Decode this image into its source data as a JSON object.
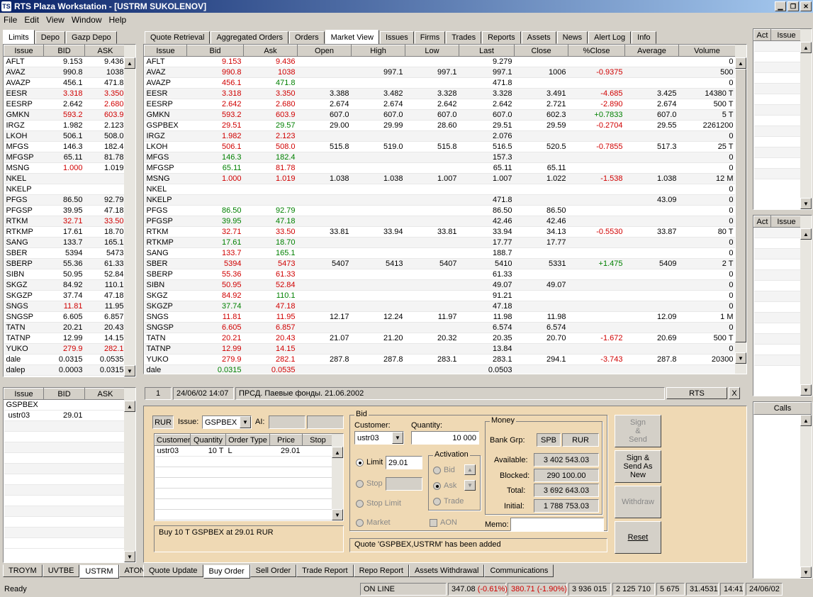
{
  "window": {
    "title": "RTS Plaza Workstation - [USTRM SUKOLENOV]"
  },
  "menu": [
    "File",
    "Edit",
    "View",
    "Window",
    "Help"
  ],
  "left_tabs": [
    "Limits",
    "Depo",
    "Gazp Depo"
  ],
  "left_grid": {
    "headers": [
      "Issue",
      "BID",
      "ASK"
    ],
    "rows": [
      [
        "AFLT",
        "9.153",
        "9.436",
        "",
        ""
      ],
      [
        "AVAZ",
        "990.8",
        "1038",
        "",
        ""
      ],
      [
        "AVAZP",
        "456.1",
        "471.8",
        "",
        ""
      ],
      [
        "EESR",
        "3.318",
        "3.350",
        "red",
        "red"
      ],
      [
        "EESRP",
        "2.642",
        "2.680",
        "",
        "red"
      ],
      [
        "GMKN",
        "593.2",
        "603.9",
        "red",
        "red"
      ],
      [
        "IRGZ",
        "1.982",
        "2.123",
        "",
        ""
      ],
      [
        "LKOH",
        "506.1",
        "508.0",
        "",
        ""
      ],
      [
        "MFGS",
        "146.3",
        "182.4",
        "",
        ""
      ],
      [
        "MFGSP",
        "65.11",
        "81.78",
        "",
        ""
      ],
      [
        "MSNG",
        "1.000",
        "1.019",
        "red",
        ""
      ],
      [
        "NKEL",
        "",
        "",
        "",
        ""
      ],
      [
        "NKELP",
        "",
        "",
        "",
        ""
      ],
      [
        "PFGS",
        "86.50",
        "92.79",
        "",
        ""
      ],
      [
        "PFGSP",
        "39.95",
        "47.18",
        "",
        ""
      ],
      [
        "RTKM",
        "32.71",
        "33.50",
        "red",
        "red"
      ],
      [
        "RTKMP",
        "17.61",
        "18.70",
        "",
        ""
      ],
      [
        "SANG",
        "133.7",
        "165.1",
        "",
        ""
      ],
      [
        "SBER",
        "5394",
        "5473",
        "",
        ""
      ],
      [
        "SBERP",
        "55.36",
        "61.33",
        "",
        ""
      ],
      [
        "SIBN",
        "50.95",
        "52.84",
        "",
        ""
      ],
      [
        "SKGZ",
        "84.92",
        "110.1",
        "",
        ""
      ],
      [
        "SKGZP",
        "37.74",
        "47.18",
        "",
        ""
      ],
      [
        "SNGS",
        "11.81",
        "11.95",
        "red",
        ""
      ],
      [
        "SNGSP",
        "6.605",
        "6.857",
        "",
        ""
      ],
      [
        "TATN",
        "20.21",
        "20.43",
        "",
        ""
      ],
      [
        "TATNP",
        "12.99",
        "14.15",
        "",
        ""
      ],
      [
        "YUKO",
        "279.9",
        "282.1",
        "red",
        "red"
      ],
      [
        "dale",
        "0.0315",
        "0.0535",
        "",
        ""
      ],
      [
        "dalep",
        "0.0003",
        "0.0315",
        "",
        ""
      ]
    ]
  },
  "left_lower_grid": {
    "headers": [
      "Issue",
      "BID",
      "ASK"
    ],
    "rows": [
      [
        "GSPBEX",
        "",
        ""
      ],
      [
        "ustr03",
        "29.01",
        ""
      ]
    ]
  },
  "left_bottom_tabs": [
    "TROYM",
    "UVTBE",
    "USTRM",
    "ATONM"
  ],
  "main_tabs": [
    "Quote Retrieval",
    "Aggregated Orders",
    "Orders",
    "Market View",
    "Issues",
    "Firms",
    "Trades",
    "Reports",
    "Assets",
    "News",
    "Alert Log",
    "Info"
  ],
  "market": {
    "headers": [
      "Issue",
      "Bid",
      "Ask",
      "Open",
      "High",
      "Low",
      "Last",
      "Close",
      "%Close",
      "Average",
      "Volume"
    ],
    "rows": [
      [
        "AFLT",
        "9.153",
        "9.436",
        "",
        "",
        "",
        "9.279",
        "",
        "",
        "",
        "0",
        "red",
        "red",
        ""
      ],
      [
        "AVAZ",
        "990.8",
        "1038",
        "",
        "997.1",
        "997.1",
        "997.1",
        "1006",
        "-0.9375",
        "",
        "500",
        "red",
        "red",
        "red"
      ],
      [
        "AVAZP",
        "456.1",
        "471.8",
        "",
        "",
        "",
        "471.8",
        "",
        "",
        "",
        "0",
        "red",
        "green",
        ""
      ],
      [
        "EESR",
        "3.318",
        "3.350",
        "3.388",
        "3.482",
        "3.328",
        "3.328",
        "3.491",
        "-4.685",
        "3.425",
        "14380 T",
        "red",
        "red",
        "red"
      ],
      [
        "EESRP",
        "2.642",
        "2.680",
        "2.674",
        "2.674",
        "2.642",
        "2.642",
        "2.721",
        "-2.890",
        "2.674",
        "500 T",
        "red",
        "red",
        "red"
      ],
      [
        "GMKN",
        "593.2",
        "603.9",
        "607.0",
        "607.0",
        "607.0",
        "607.0",
        "602.3",
        "+0.7833",
        "607.0",
        "5 T",
        "red",
        "red",
        "green"
      ],
      [
        "GSPBEX",
        "29.51",
        "29.57",
        "29.00",
        "29.99",
        "28.60",
        "29.51",
        "29.59",
        "-0.2704",
        "29.55",
        "2261200",
        "red",
        "green",
        "red"
      ],
      [
        "IRGZ",
        "1.982",
        "2.123",
        "",
        "",
        "",
        "2.076",
        "",
        "",
        "",
        "0",
        "red",
        "red",
        ""
      ],
      [
        "LKOH",
        "506.1",
        "508.0",
        "515.8",
        "519.0",
        "515.8",
        "516.5",
        "520.5",
        "-0.7855",
        "517.3",
        "25 T",
        "red",
        "red",
        "red"
      ],
      [
        "MFGS",
        "146.3",
        "182.4",
        "",
        "",
        "",
        "157.3",
        "",
        "",
        "",
        "0",
        "green",
        "green",
        ""
      ],
      [
        "MFGSP",
        "65.11",
        "81.78",
        "",
        "",
        "",
        "65.11",
        "65.11",
        "",
        "",
        "0",
        "green",
        "red",
        ""
      ],
      [
        "MSNG",
        "1.000",
        "1.019",
        "1.038",
        "1.038",
        "1.007",
        "1.007",
        "1.022",
        "-1.538",
        "1.038",
        "12 M",
        "red",
        "red",
        "red"
      ],
      [
        "NKEL",
        "",
        "",
        "",
        "",
        "",
        "",
        "",
        "",
        "",
        "0",
        "",
        "",
        ""
      ],
      [
        "NKELP",
        "",
        "",
        "",
        "",
        "",
        "471.8",
        "",
        "",
        "43.09",
        "0",
        "",
        "",
        ""
      ],
      [
        "PFGS",
        "86.50",
        "92.79",
        "",
        "",
        "",
        "86.50",
        "86.50",
        "",
        "",
        "0",
        "green",
        "green",
        ""
      ],
      [
        "PFGSP",
        "39.95",
        "47.18",
        "",
        "",
        "",
        "42.46",
        "42.46",
        "",
        "",
        "0",
        "green",
        "green",
        ""
      ],
      [
        "RTKM",
        "32.71",
        "33.50",
        "33.81",
        "33.94",
        "33.81",
        "33.94",
        "34.13",
        "-0.5530",
        "33.87",
        "80 T",
        "red",
        "red",
        "red"
      ],
      [
        "RTKMP",
        "17.61",
        "18.70",
        "",
        "",
        "",
        "17.77",
        "17.77",
        "",
        "",
        "0",
        "green",
        "green",
        ""
      ],
      [
        "SANG",
        "133.7",
        "165.1",
        "",
        "",
        "",
        "188.7",
        "",
        "",
        "",
        "0",
        "red",
        "green",
        ""
      ],
      [
        "SBER",
        "5394",
        "5473",
        "5407",
        "5413",
        "5407",
        "5410",
        "5331",
        "+1.475",
        "5409",
        "2 T",
        "red",
        "red",
        "green"
      ],
      [
        "SBERP",
        "55.36",
        "61.33",
        "",
        "",
        "",
        "61.33",
        "",
        "",
        "",
        "0",
        "red",
        "red",
        ""
      ],
      [
        "SIBN",
        "50.95",
        "52.84",
        "",
        "",
        "",
        "49.07",
        "49.07",
        "",
        "",
        "0",
        "red",
        "red",
        ""
      ],
      [
        "SKGZ",
        "84.92",
        "110.1",
        "",
        "",
        "",
        "91.21",
        "",
        "",
        "",
        "0",
        "red",
        "green",
        ""
      ],
      [
        "SKGZP",
        "37.74",
        "47.18",
        "",
        "",
        "",
        "47.18",
        "",
        "",
        "",
        "0",
        "green",
        "red",
        ""
      ],
      [
        "SNGS",
        "11.81",
        "11.95",
        "12.17",
        "12.24",
        "11.97",
        "11.98",
        "11.98",
        "",
        "12.09",
        "1 M",
        "red",
        "red",
        ""
      ],
      [
        "SNGSP",
        "6.605",
        "6.857",
        "",
        "",
        "",
        "6.574",
        "6.574",
        "",
        "",
        "0",
        "red",
        "red",
        ""
      ],
      [
        "TATN",
        "20.21",
        "20.43",
        "21.07",
        "21.20",
        "20.32",
        "20.35",
        "20.70",
        "-1.672",
        "20.69",
        "500 T",
        "red",
        "red",
        "red"
      ],
      [
        "TATNP",
        "12.99",
        "14.15",
        "",
        "",
        "",
        "13.84",
        "",
        "",
        "",
        "0",
        "red",
        "red",
        ""
      ],
      [
        "YUKO",
        "279.9",
        "282.1",
        "287.8",
        "287.8",
        "283.1",
        "283.1",
        "294.1",
        "-3.743",
        "287.8",
        "20300",
        "red",
        "red",
        "red"
      ],
      [
        "dale",
        "0.0315",
        "0.0535",
        "",
        "",
        "",
        "0.0503",
        "",
        "",
        "",
        "",
        "green",
        "red",
        ""
      ]
    ]
  },
  "news_bar": {
    "num": "1",
    "time": "24/06/02 14:07",
    "text": "ПРСД. Паевые фонды. 21.06.2002",
    "source": "RTS",
    "close": "X"
  },
  "right_top": {
    "headers": [
      "Act",
      "Issue"
    ]
  },
  "right_mid": {
    "headers": [
      "Act",
      "Issue"
    ]
  },
  "right_calls": "Calls",
  "order": {
    "currency": "RUR",
    "issue_label": "Issue:",
    "issue": "GSPBEX",
    "ai_label": "AI:",
    "grid_headers": [
      "Customer",
      "Quantity",
      "Order Type",
      "Price",
      "Stop"
    ],
    "grid_row": [
      "ustr03",
      "10 T",
      "L",
      "29.01",
      ""
    ],
    "summary": "Buy 10 T GSPBEX at 29.01 RUR",
    "bid_label": "Bid",
    "customer_label": "Customer:",
    "customer": "ustr03",
    "quantity_label": "Quantity:",
    "quantity": "10 000",
    "limit_label": "Limit",
    "limit_value": "29.01",
    "stop_label": "Stop",
    "stoplimit_label": "Stop Limit",
    "market_label": "Market",
    "activation_label": "Activation",
    "act_bid": "Bid",
    "act_ask": "Ask",
    "act_trade": "Trade",
    "aon_label": "AON",
    "money_label": "Money",
    "bank_grp_label": "Bank Grp:",
    "bank_grp": "SPB",
    "bank_cur": "RUR",
    "available_label": "Available:",
    "available": "3 402 543.03",
    "blocked_label": "Blocked:",
    "blocked": "290 100.00",
    "total_label": "Total:",
    "total": "3 692 643.03",
    "initial_label": "Initial:",
    "initial": "1 788 753.03",
    "memo_label": "Memo:",
    "message": "Quote 'GSPBEX,USTRM' has been added",
    "btn_sign_send": "Sign\n&\nSend",
    "btn_sign_send_new": "Sign &\nSend As\nNew",
    "btn_withdraw": "Withdraw",
    "btn_reset": "Reset"
  },
  "order_tabs": [
    "Quote Update",
    "Buy Order",
    "Sell Order",
    "Trade Report",
    "Repo Report",
    "Assets Withdrawal",
    "Communications"
  ],
  "status": {
    "ready": "Ready",
    "online": "ON LINE",
    "idx1": "347.08",
    "idx1chg": "(-0.61%)",
    "idx2": "380.71",
    "idx2chg": "(-1.90%)",
    "v1": "3 936 015",
    "v2": "2 125 710",
    "v3": "5 675",
    "v4": "31.4531",
    "time": "14:41",
    "date": "24/06/02"
  },
  "colors": {
    "red": "#d00000",
    "green": "#008000",
    "order_bg": "#efd9b4",
    "title_from": "#0a246a",
    "title_to": "#a6caf0"
  }
}
